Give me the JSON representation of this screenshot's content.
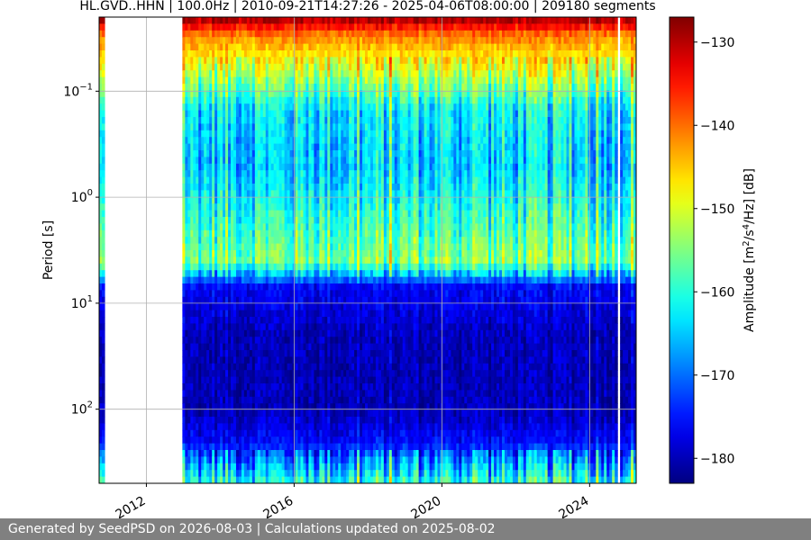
{
  "chart_data": {
    "type": "heatmap",
    "title": "HL.GVD..HHN | 100.0Hz | 2010-09-21T14:27:26 - 2025-04-06T08:00:00 | 209180 segments",
    "xlabel": "",
    "ylabel": "Period [s]",
    "x_range": [
      "2010-09-21",
      "2025-04-06"
    ],
    "y_scale": "log",
    "y_inverted": true,
    "y_range_s": [
      0.02,
      500
    ],
    "x_ticks": [
      "2012",
      "2016",
      "2020",
      "2024"
    ],
    "x_tick_years": [
      2012,
      2016,
      2020,
      2024
    ],
    "y_ticks": [
      {
        "base": "10",
        "exp": "−1",
        "value": 0.1
      },
      {
        "base": "10",
        "exp": "0",
        "value": 1
      },
      {
        "base": "10",
        "exp": "1",
        "value": 10
      },
      {
        "base": "10",
        "exp": "2",
        "value": 100
      }
    ],
    "grid": true,
    "colormap": "jet",
    "colorbar": {
      "label_prefix": "Amplitude ",
      "label_unit_parts": [
        "[m",
        "2",
        "/s",
        "4",
        "/Hz] [dB]"
      ],
      "range_db": [
        -183,
        -127
      ],
      "ticks": [
        "−130",
        "−140",
        "−150",
        "−160",
        "−170",
        "−180"
      ],
      "tick_values": [
        -130,
        -140,
        -150,
        -160,
        -170,
        -180
      ]
    },
    "data_gaps": [
      {
        "start": "2010-11-01",
        "end": "2012-12-20"
      },
      {
        "start": "2024-10-15",
        "end": "2024-11-01"
      }
    ],
    "period_profile_db": [
      {
        "period_s": 0.02,
        "db": -128
      },
      {
        "period_s": 0.03,
        "db": -141
      },
      {
        "period_s": 0.06,
        "db": -150
      },
      {
        "period_s": 0.15,
        "db": -163
      },
      {
        "period_s": 0.5,
        "db": -165
      },
      {
        "period_s": 1.5,
        "db": -160
      },
      {
        "period_s": 4,
        "db": -155
      },
      {
        "period_s": 7,
        "db": -176
      },
      {
        "period_s": 20,
        "db": -180
      },
      {
        "period_s": 100,
        "db": -180
      },
      {
        "period_s": 200,
        "db": -176
      },
      {
        "period_s": 500,
        "db": -160
      }
    ]
  },
  "footer": {
    "text": "Generated by SeedPSD on 2026-08-03 | Calculations updated on 2025-08-02"
  }
}
